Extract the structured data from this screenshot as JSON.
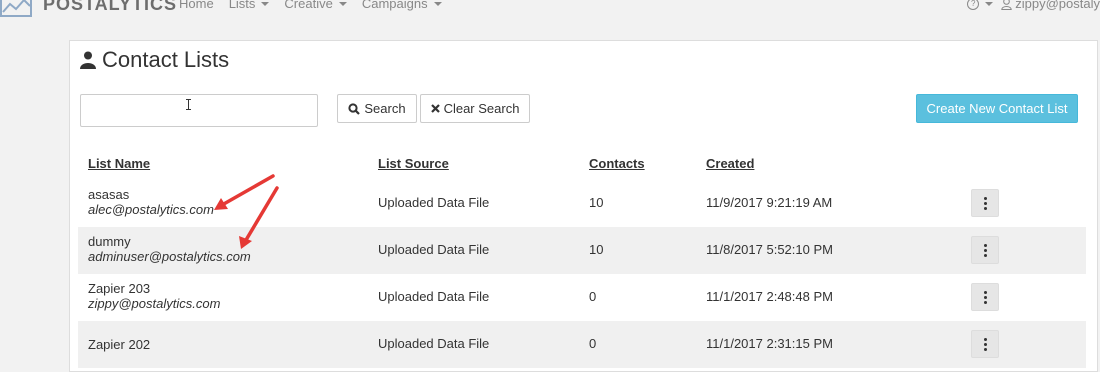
{
  "nav": {
    "brand": "POSTALYTICS",
    "links": [
      {
        "label": "Home",
        "dropdown": false
      },
      {
        "label": "Lists",
        "dropdown": true
      },
      {
        "label": "Creative",
        "dropdown": true
      },
      {
        "label": "Campaigns",
        "dropdown": true
      }
    ],
    "help_icon": "question-circle-icon",
    "user": "zippy@postaly"
  },
  "page": {
    "title": "Contact Lists",
    "title_icon": "user-icon"
  },
  "search": {
    "value": "",
    "search_label": "Search",
    "clear_label": "Clear Search",
    "create_label": "Create New Contact List"
  },
  "table": {
    "columns": [
      "List Name",
      "List Source",
      "Contacts",
      "Created"
    ],
    "rows": [
      {
        "name": "asasas",
        "email": "alec@postalytics.com",
        "source": "Uploaded Data File",
        "contacts": "10",
        "created": "11/9/2017 9:21:19 AM"
      },
      {
        "name": "dummy",
        "email": "adminuser@postalytics.com",
        "source": "Uploaded Data File",
        "contacts": "10",
        "created": "11/8/2017 5:52:10 PM"
      },
      {
        "name": "Zapier 203",
        "email": "zippy@postalytics.com",
        "source": "Uploaded Data File",
        "contacts": "0",
        "created": "11/1/2017 2:48:48 PM"
      },
      {
        "name": "Zapier 202",
        "email": "",
        "source": "Uploaded Data File",
        "contacts": "0",
        "created": "11/1/2017 2:31:15 PM"
      }
    ]
  },
  "colors": {
    "accent": "#5bc0de",
    "annotation_arrow": "#e53935"
  }
}
